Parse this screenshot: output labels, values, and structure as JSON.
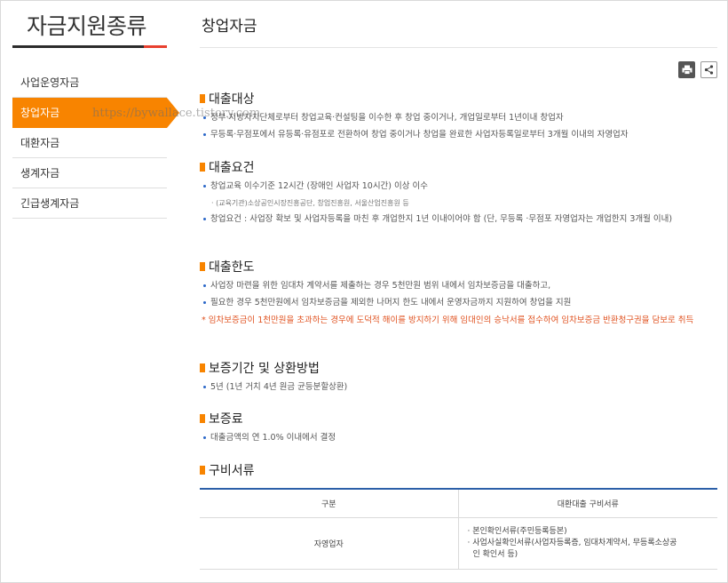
{
  "sidebar": {
    "title": "자금지원종류",
    "items": [
      {
        "label": "사업운영자금"
      },
      {
        "label": "창업자금"
      },
      {
        "label": "대환자금"
      },
      {
        "label": "생계자금"
      },
      {
        "label": "긴급생계자금"
      }
    ],
    "active_index": 1,
    "watermark": "https://bywallace.tistory.com"
  },
  "main": {
    "title": "창업자금",
    "sections": {
      "target": {
        "heading": "대출대상",
        "bullets": [
          "정부·지방자치단체로부터 창업교육·컨설팅을 이수한 후 창업 중이거나, 개업일로부터 1년이내 창업자",
          "무등록·무점포에서 유등록·유점포로 전환하여 창업 중이거나 창업을 완료한 사업자등록일로부터 3개월 이내의 자영업자"
        ]
      },
      "requirements": {
        "heading": "대출요건",
        "bullet1": "창업교육 이수기준 12시간 (장애인 사업자 10시간) 이상 이수",
        "sub1": "· (교육기관)소상공인시장진흥공단, 창업진흥원, 서울산업진흥원 등",
        "bullet2": "창업요건 : 사업장 확보 및 사업자등록을 마친 후 개업한지 1년 이내이어야 함 (단, 무등록 ·무점포 자영업자는 개업한지 3개월 이내)"
      },
      "limit": {
        "heading": "대출한도",
        "bullets": [
          "사업장 마련을 위한 임대차 계약서를 제출하는 경우 5천만원 범위 내에서 임차보증금을 대출하고,",
          "필요한 경우 5천만원에서 임차보증금을 제외한 나머지 한도 내에서 운영자금까지 지원하여 창업을 지원"
        ],
        "warning": "* 임차보증금이 1천만원을 초과하는 경우에 도덕적 해이를 방지하기 위해 임대인의 승낙서를 접수하여 임차보증금 반환청구권을 담보로 취득"
      },
      "repayment": {
        "heading": "보증기간 및 상환방법",
        "bullet": "5년 (1년 거치 4년 원금 균등분할상환)"
      },
      "fee": {
        "heading": "보증료",
        "bullet": "대출금액의 연 1.0% 이내에서 결정"
      },
      "documents": {
        "heading": "구비서류",
        "table": {
          "col1": "구분",
          "col2": "대환대출 구비서류",
          "row_label": "자영업자",
          "row_items": [
            "· 본인확인서류(주민등록등본)",
            "· 사업사실확인서류(사업자등록증, 임대차계약서, 무등록소상공",
            "인 확인서 등)"
          ]
        }
      }
    }
  },
  "icons": {
    "print": "print-icon",
    "share": "share-icon"
  },
  "colors": {
    "accent": "#f88400",
    "title_bar_red": "#e8402e",
    "table_top": "#2b5fa8",
    "bullet_blue": "#2a67c8",
    "warning": "#e05220"
  }
}
